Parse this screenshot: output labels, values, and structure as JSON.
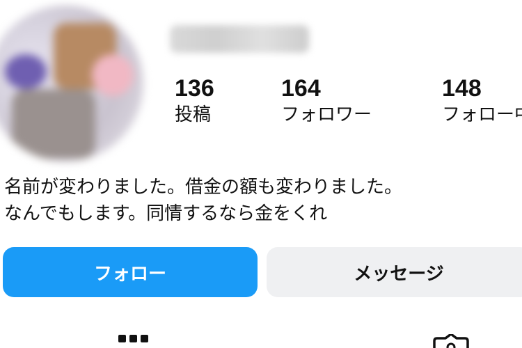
{
  "profile": {
    "stats": {
      "posts": {
        "count": "136",
        "label": "投稿"
      },
      "followers": {
        "count": "164",
        "label": "フォロワー"
      },
      "following": {
        "count": "148",
        "label": "フォロー中"
      }
    },
    "bio": {
      "line1": "名前が変わりました。借金の額も変わりました。",
      "line2": "なんでもします。同情するなら金をくれ"
    }
  },
  "actions": {
    "follow_label": "フォロー",
    "message_label": "メッセージ"
  },
  "tabs": [
    {
      "icon": "grid-icon"
    },
    {
      "icon": "tagged-person-icon"
    }
  ],
  "colors": {
    "follow_button": "#1a9bf7",
    "message_button": "#eff0f2",
    "text": "#111111"
  }
}
